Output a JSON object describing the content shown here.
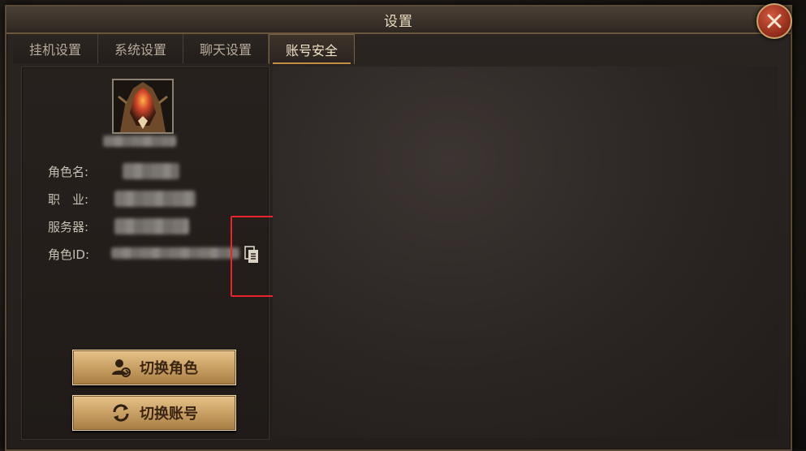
{
  "window": {
    "title": "设置"
  },
  "tabs": [
    {
      "label": "挂机设置",
      "active": false
    },
    {
      "label": "系统设置",
      "active": false
    },
    {
      "label": "聊天设置",
      "active": false
    },
    {
      "label": "账号安全",
      "active": true
    }
  ],
  "account": {
    "role_name_label": "角色名:",
    "class_label": "职　业:",
    "server_label": "服务器:",
    "role_id_label": "角色ID:"
  },
  "buttons": {
    "switch_role": "切换角色",
    "switch_account": "切换账号"
  },
  "icons": {
    "close": "close-icon",
    "copy": "copy-icon",
    "switch_role": "user-switch-icon",
    "switch_account": "refresh-icon"
  },
  "colors": {
    "accent": "#c9a064",
    "highlight": "#e8242c",
    "close": "#8e2a1a"
  }
}
